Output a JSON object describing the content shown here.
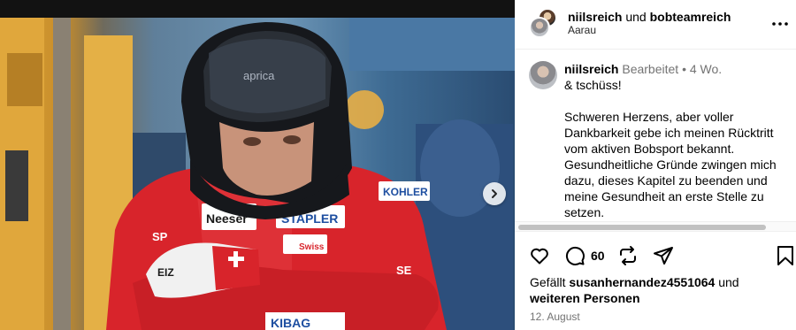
{
  "header": {
    "user1": "niilsreich",
    "conjunction": "und",
    "user2": "bobteamreich",
    "location": "Aarau"
  },
  "caption": {
    "username": "niilsreich",
    "edited": "Bearbeitet",
    "separator": "•",
    "age": "4 Wo.",
    "body": "& tschüss!\n\nSchweren Herzens, aber voller Dankbarkeit gebe ich meinen Rücktritt vom aktiven Bobsport bekannt. Gesundheitliche Gründe zwingen mich dazu, dieses Kapitel zu beenden und meine Gesundheit an erste Stelle zu setzen."
  },
  "actions": {
    "comment_count": "60"
  },
  "likes": {
    "prefix": "Gefällt",
    "user": "susanhernandez4551064",
    "mid": "und",
    "others": "weiteren Personen"
  },
  "date": "12. August",
  "icons": [
    "heart-icon",
    "comment-icon",
    "repost-icon",
    "share-icon",
    "bookmark-icon",
    "more-icon",
    "chevron-right-icon"
  ],
  "photo": {
    "helmet_text": [
      "aprica"
    ],
    "suit_text": [
      "Neeser",
      "STAPLER",
      "KOHLER",
      "Swiss",
      "KIBAG",
      "SE",
      "SP",
      "EIZ"
    ]
  }
}
